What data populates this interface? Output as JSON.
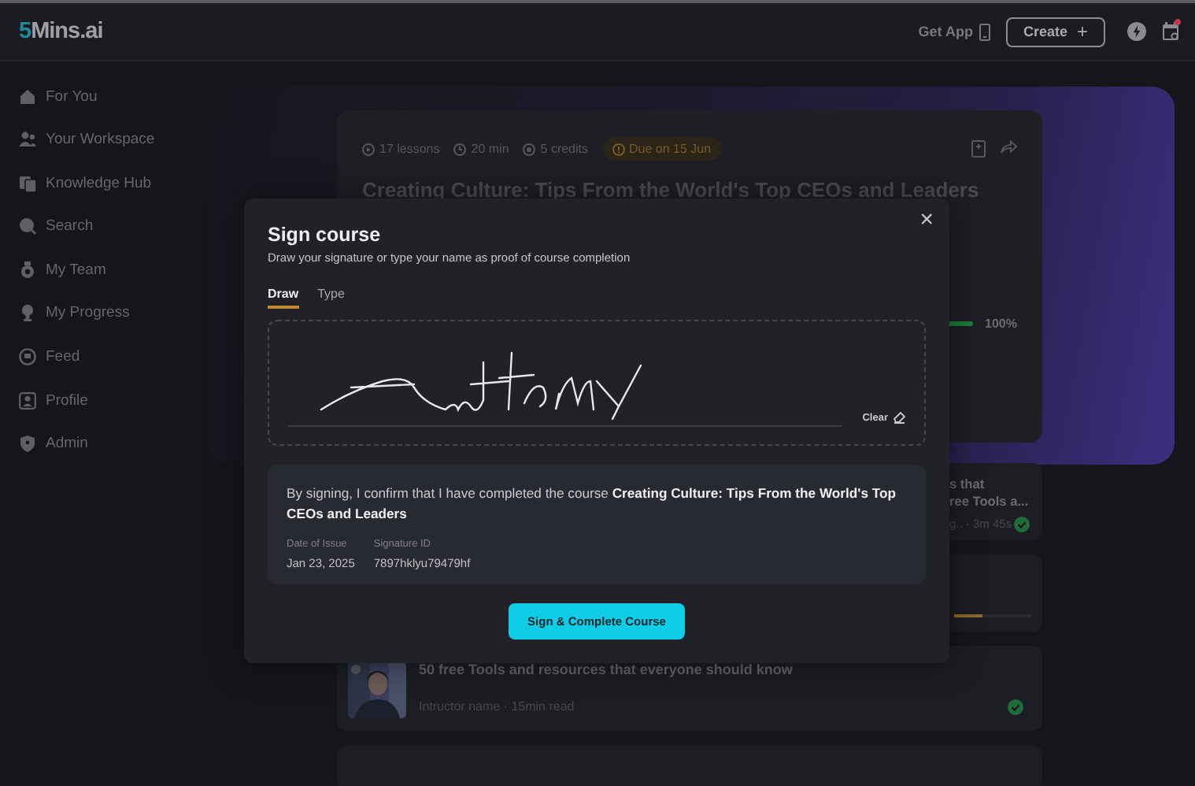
{
  "header": {
    "logo_accent": "5",
    "logo_rest": "Mins.ai",
    "get_app": "Get App",
    "create": "Create",
    "create_icon": "+",
    "has_notification": true
  },
  "sidebar": {
    "items": [
      {
        "label": "For You"
      },
      {
        "label": "Your Workspace"
      },
      {
        "label": "Knowledge Hub"
      },
      {
        "label": "Search"
      },
      {
        "label": "My Team"
      },
      {
        "label": "My Progress"
      },
      {
        "label": "Feed"
      },
      {
        "label": "Profile"
      },
      {
        "label": "Admin"
      }
    ]
  },
  "course": {
    "meta": [
      {
        "kind": "lessons",
        "text": "17 lessons"
      },
      {
        "kind": "time",
        "text": "20 min"
      },
      {
        "kind": "credits",
        "text": "5 credits"
      }
    ],
    "due": "Due on 15 Jun",
    "title": "Creating Culture: Tips From the World's Top CEOs and Leaders",
    "progress": {
      "level": 1,
      "reading": "100%"
    }
  },
  "cards": [
    {
      "kind": "partial",
      "title_lines": [
        "s that",
        "ree Tools a..."
      ],
      "meta": "g.. · 3m 45s",
      "done": true
    },
    {
      "kind": "progress",
      "level": 0.37
    },
    {
      "kind": "article",
      "title": "50 free Tools and resources that everyone should know",
      "meta": "Intructor name · 15min read",
      "done": true
    },
    {
      "kind": "empty"
    }
  ],
  "modal": {
    "title": "Sign course",
    "subtitle": "Draw your signature or type your name as proof of course completion",
    "close": "×",
    "tabs": [
      {
        "label": "Draw",
        "selected": true
      },
      {
        "label": "Type",
        "selected": false
      }
    ],
    "clear": "Clear",
    "statement": "By signing, I confirm that I have  completed the course **Creating Culture: Tips From the World's Top CEOs and Leaders**",
    "fields": [
      {
        "label": "Date of Issue",
        "value": "Jan 23, 2025"
      },
      {
        "label": "Signature ID",
        "value": "7897hklyu79479hf"
      }
    ],
    "button": "Sign & Complete Course"
  }
}
